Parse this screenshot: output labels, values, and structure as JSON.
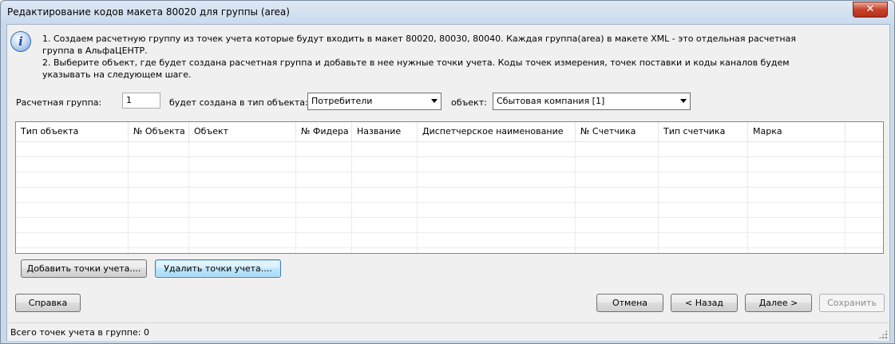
{
  "window": {
    "title": "Редактирование кодов макета 80020 для группы (area)",
    "close_glyph": "✕"
  },
  "info": {
    "icon": "info-icon",
    "icon_glyph": "i",
    "lines": [
      "1. Создаем расчетную группу из точек учета которые будут входить в макет 80020, 80030, 80040. Каждая группа(area) в макете XML - это отдельная расчетная",
      "группа в АльфаЦЕНТР.",
      "2. Выберите объект, где будет создана расчетная группа и добавьте в нее нужные точки учета. Коды точек измерения, точек поставки и коды каналов будем",
      "указывать на следующем шаге."
    ]
  },
  "form": {
    "group_label": "Расчетная группа:",
    "group_value": "1",
    "type_label": "будет создана в тип  объекта:",
    "type_value": "Потребители",
    "object_label": "объект:",
    "object_value": "Сбытовая компания [1]"
  },
  "table": {
    "columns": [
      "Тип объекта",
      "№ Объекта",
      "Объект",
      "№ Фидера",
      "Название",
      "Диспетчерское наименование",
      "№ Счетчика",
      "Тип счетчика",
      "Марка"
    ]
  },
  "buttons": {
    "add_points": "Добавить точки учета....",
    "remove_points": "Удалить точки учета....",
    "help": "Справка",
    "cancel": "Отмена",
    "back": "< Назад",
    "next": "Далее >",
    "save": "Сохранить"
  },
  "status": {
    "text": "Всего точек учета в группе: 0"
  }
}
